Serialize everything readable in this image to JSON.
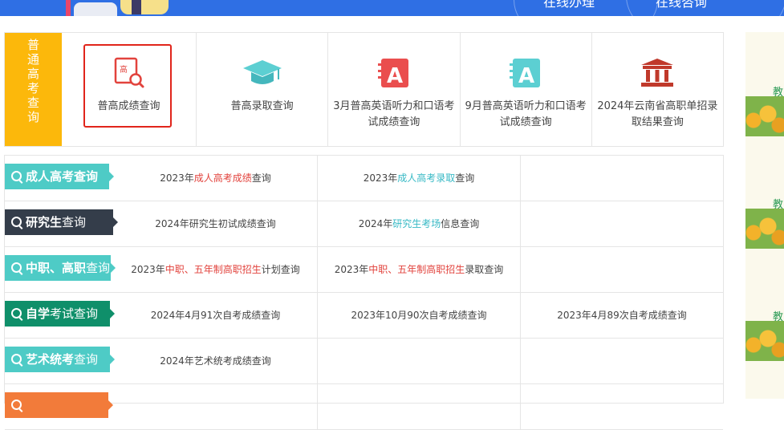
{
  "banner": {
    "nav": [
      "在线办理",
      "在线咨询"
    ]
  },
  "top_section": {
    "side_tab": [
      "普",
      "通",
      "高",
      "考",
      "查",
      "询"
    ],
    "items": [
      {
        "label": "普高成绩查询",
        "icon": "gaokao-search-icon",
        "icon_text": "高",
        "selected": true
      },
      {
        "label": "普高录取查询",
        "icon": "graduation-cap-icon"
      },
      {
        "label": "3月普高英语听力和口语考试成绩查询",
        "icon": "letter-a-red-icon",
        "icon_text": "A"
      },
      {
        "label": "9月普高英语听力和口语考试成绩查询",
        "icon": "letter-a-teal-icon",
        "icon_text": "A"
      },
      {
        "label": "2024年云南省高职单招录取结果查询",
        "icon": "school-building-icon"
      }
    ]
  },
  "rows": [
    {
      "tag": {
        "bold": "成人高考查询",
        "rest": "",
        "color": "#4ecbc6"
      },
      "cells": [
        {
          "pre": "2023年",
          "hl": "成人高考成绩",
          "hl_color": "red",
          "post": "查询"
        },
        {
          "pre": "2023年",
          "hl": "成人高考录取",
          "hl_color": "teal",
          "post": "查询"
        },
        {
          "pre": "",
          "hl": "",
          "post": ""
        }
      ]
    },
    {
      "tag": {
        "bold": "研究生",
        "rest": "查询",
        "color": "#343d4a"
      },
      "cells": [
        {
          "pre": "2024年研究生初试成绩查询",
          "hl": "",
          "post": ""
        },
        {
          "pre": "2024年",
          "hl": "研究生考场",
          "hl_color": "teal",
          "post": "信息查询"
        },
        {
          "pre": "",
          "hl": "",
          "post": ""
        }
      ]
    },
    {
      "tag": {
        "bold": "中职、高职",
        "rest": "查询",
        "color": "#4ecbc6"
      },
      "cells": [
        {
          "pre": "2023年",
          "hl": "中职、五年制高职招生",
          "hl_color": "red",
          "post": "计划查询"
        },
        {
          "pre": "2023年",
          "hl": "中职、五年制高职招生",
          "hl_color": "red",
          "post": "录取查询"
        },
        {
          "pre": "",
          "hl": "",
          "post": ""
        }
      ]
    },
    {
      "tag": {
        "bold": "自学",
        "rest": "考试查询",
        "color": "#0f8f6a"
      },
      "cells": [
        {
          "pre": "2024年4月91次自考成绩查询",
          "hl": "",
          "post": ""
        },
        {
          "pre": "2023年10月90次自考成绩查询",
          "hl": "",
          "post": ""
        },
        {
          "pre": "2023年4月89次自考成绩查询",
          "hl": "",
          "post": ""
        }
      ]
    },
    {
      "tag": {
        "bold": "艺术统考",
        "rest": "查询",
        "color": "#4ecbc6"
      },
      "cells": [
        {
          "pre": "2024年艺术统考成绩查询",
          "hl": "",
          "post": ""
        },
        {
          "pre": "",
          "hl": "",
          "post": ""
        },
        {
          "pre": "",
          "hl": "",
          "post": ""
        }
      ]
    },
    {
      "tag": {
        "bold": "",
        "rest": "",
        "color": "#f27b3a"
      },
      "cells": [
        {
          "pre": "",
          "hl": "",
          "post": ""
        },
        {
          "pre": "",
          "hl": "",
          "post": ""
        },
        {
          "pre": "",
          "hl": "",
          "post": ""
        }
      ]
    }
  ],
  "ads": [
    "教",
    "教",
    "教"
  ],
  "colors": {
    "red": "#e2433d",
    "teal": "#37b9c5",
    "yellow": "#fcb80b",
    "banner": "#2f6fe4"
  }
}
